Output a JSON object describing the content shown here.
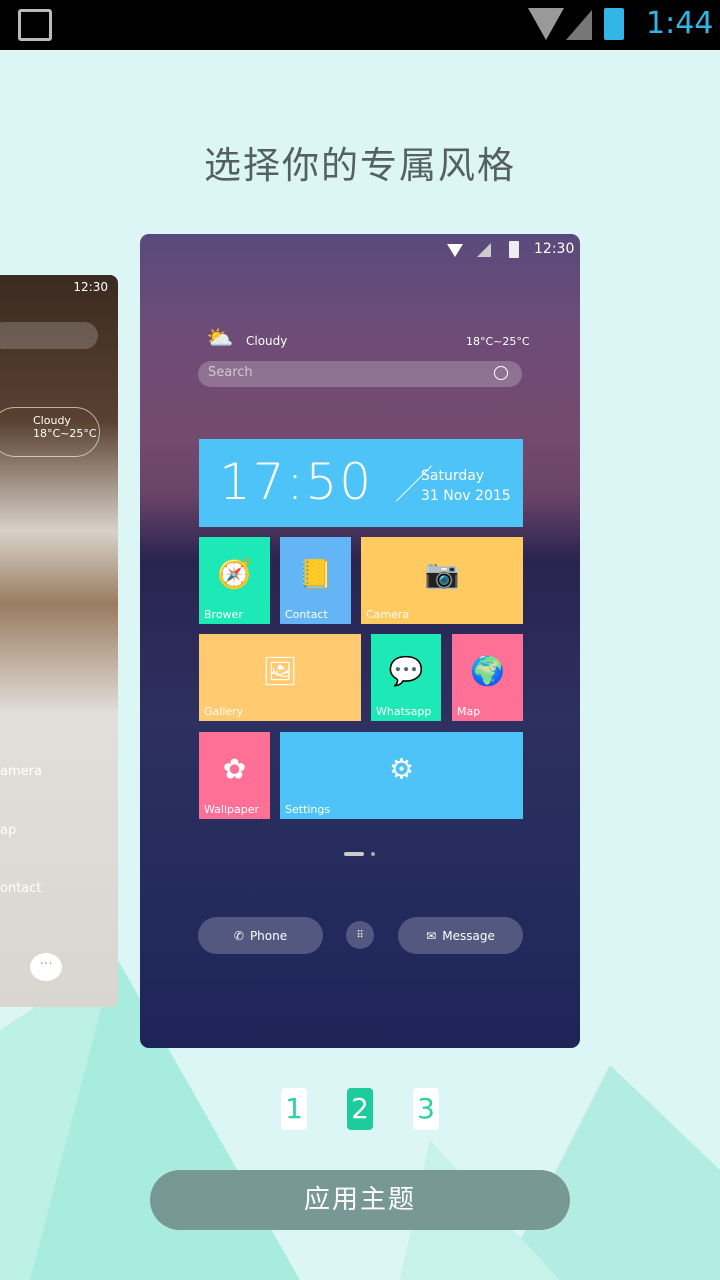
{
  "status_bar": {
    "time": "1:44"
  },
  "title": "选择你的专属风格",
  "left_preview": {
    "time": "12:30",
    "weather": "Cloudy",
    "temp": "18°C~25°C",
    "items": [
      "amera",
      "ap",
      "ontact"
    ]
  },
  "main_preview": {
    "time": "12:30",
    "weather": "Cloudy",
    "temp": "18°C~25°C",
    "search_placeholder": "Search",
    "clock": "17:50",
    "day": "Saturday",
    "date": "31 Nov 2015",
    "tiles": [
      {
        "label": "Brower",
        "icon": "compass-icon",
        "color": "#1de9b6"
      },
      {
        "label": "Contact",
        "icon": "contact-book-icon",
        "color": "#64b5f6"
      },
      {
        "label": "Camera",
        "icon": "camera-icon",
        "color": "#ffca5f"
      },
      {
        "label": "Gallery",
        "icon": "image-icon",
        "color": "#ffca70"
      },
      {
        "label": "Whatsapp",
        "icon": "whatsapp-icon",
        "color": "#1de9b6"
      },
      {
        "label": "Map",
        "icon": "globe-icon",
        "color": "#ff7096"
      },
      {
        "label": "Wallpaper",
        "icon": "flower-icon",
        "color": "#ff7096"
      },
      {
        "label": "Settings",
        "icon": "gear-icon",
        "color": "#4dc3f7"
      }
    ],
    "dock": {
      "phone": "Phone",
      "message": "Message"
    }
  },
  "pager": [
    "1",
    "2",
    "3"
  ],
  "pager_active": 1,
  "apply_button": "应用主题",
  "colors": {
    "accent": "#1ecb9d",
    "clock_tile": "#4dc3f7",
    "status_time": "#33b5e5"
  }
}
